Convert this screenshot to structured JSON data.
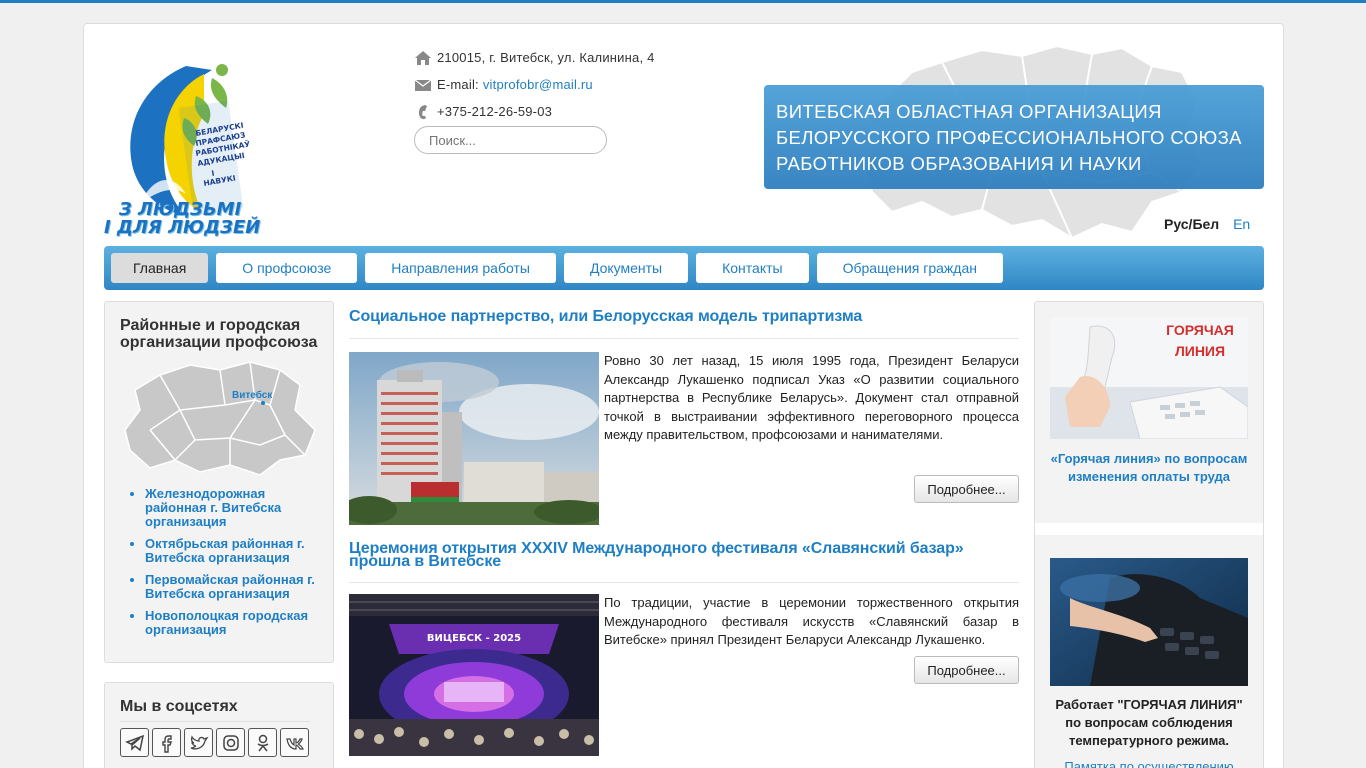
{
  "header": {
    "logo_text_line1": "З ЛЮДЗЬМІ",
    "logo_text_line2": "І ДЛЯ ЛЮДЗЕЙ",
    "logo_ribbon": "БЕЛАРУСКІ ПРАФСАЮЗ РАБОТНІКАЎ АДУКАЦЫІ І НАВУКІ",
    "address": "210015, г. Витебск, ул. Калинина, 4",
    "email_label": "E-mail:",
    "email": "vitprofobr@mail.ru",
    "phone": "+375-212-26-59-03",
    "search_placeholder": "Поиск...",
    "banner_line1": "Витебская областная организация",
    "banner_line2": "Белорусского профессионального союза",
    "banner_line3": "работников образования и науки",
    "lang_ru": "Рус/Бел",
    "lang_en": "En"
  },
  "nav": {
    "items": [
      {
        "label": "Главная"
      },
      {
        "label": "О профсоюзе"
      },
      {
        "label": "Направления работы"
      },
      {
        "label": "Документы"
      },
      {
        "label": "Контакты"
      },
      {
        "label": "Обращения граждан"
      }
    ]
  },
  "left": {
    "title": "Районные и городская организации профсоюза",
    "map_label": "Витебск",
    "links": [
      "Железнодорожная районная г. Витебска организация",
      "Октябрьская районная г. Витебска организация",
      "Первомайская районная г. Витебска организация",
      "Новополоцкая городская организация"
    ],
    "social_title": "Мы в соцсетях",
    "social_icons": [
      "telegram-icon",
      "facebook-icon",
      "twitter-icon",
      "instagram-icon",
      "odnoklassniki-icon",
      "vk-icon"
    ]
  },
  "articles": [
    {
      "title": "Социальное партнерство, или Белорусская модель трипартизма",
      "text": "Ровно 30 лет назад, 15 июля 1995 года, Президент Беларуси Александр Лукашенко подписал Указ «О развитии социального партнерства в Республике Беларусь». Документ стал отправной точкой в выстраивании эффективного переговорного процесса между правительством, профсоюзами и нанимателями.",
      "more": "Подробнее..."
    },
    {
      "title": "Церемония открытия XXXIV Международного фестиваля «Славянский базар» прошла в Витебске",
      "image_text": "ВИЦЕБСК - 2025",
      "text": "По традиции, участие в церемонии торжественного открытия Международного фестиваля искусств «Славянский базар в Витебске» принял Президент Беларуси Александр Лукашенко.",
      "more": "Подробнее..."
    }
  ],
  "right": {
    "hotline_label_line1": "ГОРЯЧАЯ",
    "hotline_label_line2": "ЛИНИЯ",
    "caption1": "«Горячая линия» по вопросам изменения оплаты труда",
    "caption2": "Работает \"ГОРЯЧАЯ ЛИНИЯ\" по вопросам соблюдения температурного режима.",
    "caption3": "Памятка по осуществлению"
  },
  "colors": {
    "accent": "#1f7fc4",
    "nav_top": "#5db1e0",
    "nav_bottom": "#2f86c4"
  }
}
